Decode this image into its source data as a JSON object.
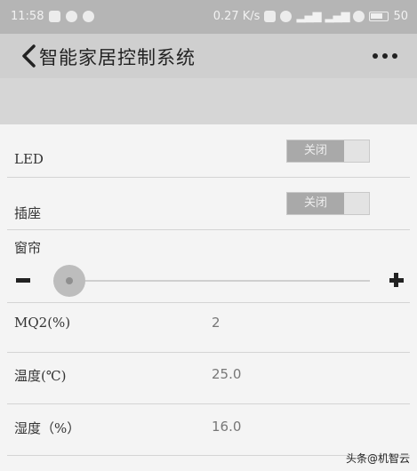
{
  "status_bar": {
    "time": "11:58",
    "speed": "0.27 K/s",
    "battery": "50"
  },
  "header": {
    "title": "智能家居控制系统"
  },
  "controls": {
    "led": {
      "label": "LED",
      "switch_text": "关闭",
      "state": "off"
    },
    "socket": {
      "label": "插座",
      "switch_text": "关闭",
      "state": "off"
    },
    "curtain": {
      "label": "窗帘",
      "slider_level": 0.05
    }
  },
  "sensors": [
    {
      "label": "MQ2(%)",
      "value": "2"
    },
    {
      "label": "温度(℃)",
      "value": "25.0"
    },
    {
      "label": "湿度（%）",
      "value": "16.0"
    }
  ],
  "watermark": "头条@机智云",
  "colors": {
    "status_bar": "#b5b5b5",
    "title_bar": "#cfcfcf",
    "switch_off": "#a9a9a9"
  }
}
